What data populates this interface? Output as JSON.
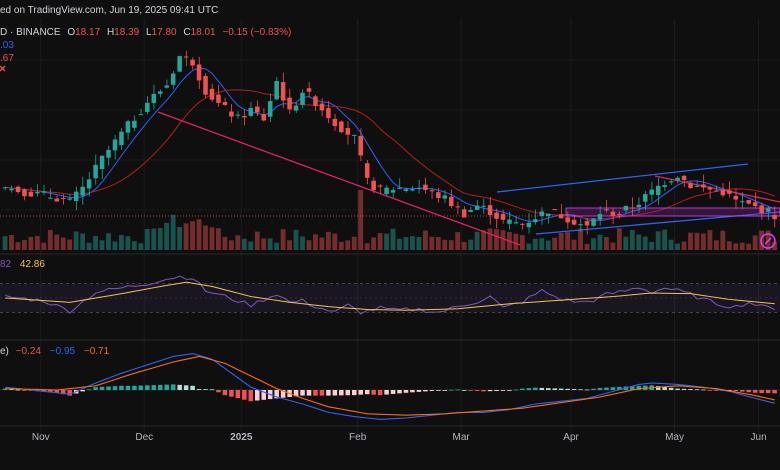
{
  "header": {
    "published": "ed on TradingView.com, Jun 19, 2025 09:41 UTC",
    "symbol": "D · BINANCE",
    "o_label": "O",
    "o_value": "18.17",
    "h_label": "H",
    "h_value": "18.39",
    "l_label": "L",
    "l_value": "17.80",
    "c_label": "C",
    "c_value": "18.01",
    "change": "−0.15 (−0.83%)",
    "ma_value_1": ".03",
    "ma_value_2": ".67",
    "close_icon": "close-icon"
  },
  "rsi": {
    "value_a": "82",
    "value_b": "42.86"
  },
  "macd": {
    "label": "e)",
    "v1": "−0.24",
    "v2": "−0.95",
    "v3": "−0.71"
  },
  "logo_icon": "tradingview-logo-icon",
  "colors": {
    "background": "#0f0f0f",
    "up": "#26a69a",
    "down": "#ef5350",
    "ma_fast": "#2962ff",
    "ma_slow": "#b71c1c",
    "channel_down": "#e91e63",
    "channel_up": "#2962ff",
    "rsi": "#7e57c2",
    "rsi_ma": "#f5c542",
    "macd_line": "#2962ff",
    "signal_line": "#ff6d00"
  },
  "chart_data": {
    "type": "candlestick",
    "x_ticks": [
      "Nov",
      "Dec",
      "2025",
      "Feb",
      "Mar",
      "Apr",
      "May",
      "Jun"
    ],
    "price_path": [
      [
        0,
        15.5
      ],
      [
        4,
        15.0
      ],
      [
        8,
        14.6
      ],
      [
        10,
        14.2
      ],
      [
        12,
        15.4
      ],
      [
        15,
        18.0
      ],
      [
        18,
        20.2
      ],
      [
        22,
        23.0
      ],
      [
        25,
        24.5
      ],
      [
        27,
        27.0
      ],
      [
        29,
        26.5
      ],
      [
        31,
        24.0
      ],
      [
        33,
        22.8
      ],
      [
        36,
        21.5
      ],
      [
        38,
        22.3
      ],
      [
        40,
        21.5
      ],
      [
        42,
        24.8
      ],
      [
        44,
        22.0
      ],
      [
        46,
        24.0
      ],
      [
        48,
        23.0
      ],
      [
        51,
        21.2
      ],
      [
        54,
        19.8
      ],
      [
        56,
        16.0
      ],
      [
        58,
        15.2
      ],
      [
        60,
        15.4
      ],
      [
        64,
        15.5
      ],
      [
        68,
        14.5
      ],
      [
        71,
        13.2
      ],
      [
        73,
        13.9
      ],
      [
        75,
        13.4
      ],
      [
        77,
        12.5
      ],
      [
        80,
        12.3
      ],
      [
        84,
        13.5
      ],
      [
        87,
        12.8
      ],
      [
        90,
        12.0
      ],
      [
        92,
        13.3
      ],
      [
        95,
        13.2
      ],
      [
        98,
        14.2
      ],
      [
        100,
        15.1
      ],
      [
        102,
        16.0
      ],
      [
        104,
        16.6
      ],
      [
        106,
        15.7
      ],
      [
        108,
        15.4
      ],
      [
        111,
        15.1
      ],
      [
        113,
        14.3
      ],
      [
        115,
        13.9
      ],
      [
        117,
        13.6
      ],
      [
        119,
        13.0
      ]
    ],
    "rsi_path": [
      [
        0,
        52
      ],
      [
        6,
        46
      ],
      [
        10,
        32
      ],
      [
        14,
        58
      ],
      [
        18,
        64
      ],
      [
        22,
        70
      ],
      [
        24,
        75
      ],
      [
        27,
        80
      ],
      [
        29,
        78
      ],
      [
        31,
        60
      ],
      [
        34,
        52
      ],
      [
        36,
        46
      ],
      [
        38,
        40
      ],
      [
        40,
        48
      ],
      [
        42,
        56
      ],
      [
        44,
        44
      ],
      [
        46,
        46
      ],
      [
        48,
        38
      ],
      [
        51,
        30
      ],
      [
        53,
        40
      ],
      [
        55,
        30
      ],
      [
        58,
        36
      ],
      [
        60,
        33
      ],
      [
        64,
        34
      ],
      [
        67,
        30
      ],
      [
        70,
        38
      ],
      [
        73,
        45
      ],
      [
        75,
        52
      ],
      [
        77,
        36
      ],
      [
        80,
        45
      ],
      [
        83,
        60
      ],
      [
        86,
        48
      ],
      [
        89,
        44
      ],
      [
        91,
        47
      ],
      [
        93,
        55
      ],
      [
        96,
        60
      ],
      [
        98,
        65
      ],
      [
        100,
        58
      ],
      [
        102,
        64
      ],
      [
        104,
        60
      ],
      [
        106,
        55
      ],
      [
        108,
        48
      ],
      [
        111,
        40
      ],
      [
        113,
        38
      ],
      [
        115,
        44
      ],
      [
        117,
        38
      ],
      [
        119,
        36
      ]
    ],
    "rsi_ma_path": [
      [
        0,
        50
      ],
      [
        10,
        44
      ],
      [
        18,
        56
      ],
      [
        24,
        66
      ],
      [
        28,
        72
      ],
      [
        32,
        66
      ],
      [
        38,
        52
      ],
      [
        44,
        44
      ],
      [
        50,
        38
      ],
      [
        56,
        34
      ],
      [
        62,
        33
      ],
      [
        70,
        35
      ],
      [
        78,
        42
      ],
      [
        86,
        47
      ],
      [
        94,
        52
      ],
      [
        100,
        57
      ],
      [
        106,
        56
      ],
      [
        112,
        48
      ],
      [
        119,
        42
      ]
    ],
    "macd_path": [
      [
        0,
        0.2
      ],
      [
        6,
        -0.1
      ],
      [
        10,
        -0.3
      ],
      [
        14,
        0.5
      ],
      [
        18,
        1.2
      ],
      [
        22,
        1.8
      ],
      [
        26,
        2.4
      ],
      [
        29,
        2.6
      ],
      [
        32,
        2.2
      ],
      [
        35,
        1.2
      ],
      [
        38,
        0.2
      ],
      [
        42,
        -0.5
      ],
      [
        46,
        -1.0
      ],
      [
        50,
        -1.6
      ],
      [
        54,
        -1.9
      ],
      [
        58,
        -2.1
      ],
      [
        62,
        -2.0
      ],
      [
        66,
        -1.8
      ],
      [
        70,
        -1.6
      ],
      [
        74,
        -1.6
      ],
      [
        78,
        -1.4
      ],
      [
        82,
        -1.0
      ],
      [
        86,
        -0.8
      ],
      [
        90,
        -0.6
      ],
      [
        94,
        -0.1
      ],
      [
        98,
        0.4
      ],
      [
        100,
        0.5
      ],
      [
        104,
        0.4
      ],
      [
        108,
        0.2
      ],
      [
        112,
        -0.1
      ],
      [
        116,
        -0.6
      ],
      [
        119,
        -0.95
      ]
    ],
    "signal_path": [
      [
        0,
        0.1
      ],
      [
        8,
        0.0
      ],
      [
        14,
        0.3
      ],
      [
        20,
        1.2
      ],
      [
        26,
        2.0
      ],
      [
        30,
        2.4
      ],
      [
        34,
        1.9
      ],
      [
        38,
        1.0
      ],
      [
        42,
        0.1
      ],
      [
        46,
        -0.6
      ],
      [
        50,
        -1.2
      ],
      [
        56,
        -1.7
      ],
      [
        62,
        -1.8
      ],
      [
        68,
        -1.7
      ],
      [
        74,
        -1.5
      ],
      [
        80,
        -1.3
      ],
      [
        86,
        -0.9
      ],
      [
        92,
        -0.5
      ],
      [
        98,
        0.1
      ],
      [
        104,
        0.3
      ],
      [
        110,
        0.1
      ],
      [
        116,
        -0.4
      ],
      [
        119,
        -0.71
      ]
    ],
    "rsi_levels": [
      70,
      30
    ],
    "n_candles": 120
  }
}
